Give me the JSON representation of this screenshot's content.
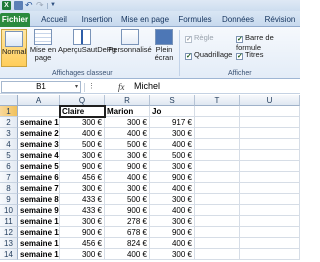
{
  "qat": {
    "excel_icon_label": "X",
    "undo_glyph": "↶",
    "redo_glyph": "↷",
    "dropdown_glyph": "▼"
  },
  "tabs": [
    {
      "label": "Fichier",
      "kind": "file"
    },
    {
      "label": "Accueil",
      "kind": "normal"
    },
    {
      "label": "Insertion",
      "kind": "normal"
    },
    {
      "label": "Mise en page",
      "kind": "normal"
    },
    {
      "label": "Formules",
      "kind": "normal"
    },
    {
      "label": "Données",
      "kind": "normal"
    },
    {
      "label": "Révision",
      "kind": "normal"
    }
  ],
  "ribbon": {
    "views": {
      "normal": "Normal",
      "page_layout": "Mise en\npage",
      "page_break": "AperçuSautDePg",
      "custom": "Personnalisé",
      "full_screen": "Plein\nécran",
      "group_label": "Affichages classeur"
    },
    "show": {
      "ruler": "Règle",
      "formula_bar": "Barre de formule",
      "gridlines": "Quadrillage",
      "headings": "Titres",
      "group_label": "Afficher",
      "check_glyph": "✓"
    }
  },
  "formula_bar": {
    "name_box": "B1",
    "name_box_arrow": "▾",
    "dots": "⋮",
    "fx": "fx",
    "value": "Michel"
  },
  "grid": {
    "columns": [
      "A",
      "Q",
      "R",
      "S",
      "T",
      "U"
    ],
    "selected_column": "B",
    "rows": [
      {
        "n": "1",
        "cells": [
          "",
          "Claire",
          "Marion",
          "Jo",
          "",
          ""
        ]
      },
      {
        "n": "2",
        "cells": [
          "semaine 1",
          "300 €",
          "300 €",
          "917 €",
          "",
          ""
        ]
      },
      {
        "n": "3",
        "cells": [
          "semaine 2",
          "400 €",
          "400 €",
          "300 €",
          "",
          ""
        ]
      },
      {
        "n": "4",
        "cells": [
          "semaine 3",
          "500 €",
          "500 €",
          "400 €",
          "",
          ""
        ]
      },
      {
        "n": "5",
        "cells": [
          "semaine 4",
          "300 €",
          "300 €",
          "500 €",
          "",
          ""
        ]
      },
      {
        "n": "6",
        "cells": [
          "semaine 5",
          "900 €",
          "900 €",
          "300 €",
          "",
          ""
        ]
      },
      {
        "n": "7",
        "cells": [
          "semaine 6",
          "456 €",
          "400 €",
          "900 €",
          "",
          ""
        ]
      },
      {
        "n": "8",
        "cells": [
          "semaine 7",
          "300 €",
          "300 €",
          "400 €",
          "",
          ""
        ]
      },
      {
        "n": "9",
        "cells": [
          "semaine 8",
          "433 €",
          "500 €",
          "300 €",
          "",
          ""
        ]
      },
      {
        "n": "10",
        "cells": [
          "semaine 9",
          "433 €",
          "900 €",
          "400 €",
          "",
          ""
        ]
      },
      {
        "n": "11",
        "cells": [
          "semaine 10",
          "300 €",
          "278 €",
          "300 €",
          "",
          ""
        ]
      },
      {
        "n": "12",
        "cells": [
          "semaine 11",
          "900 €",
          "678 €",
          "900 €",
          "",
          ""
        ]
      },
      {
        "n": "13",
        "cells": [
          "semaine 12",
          "456 €",
          "824 €",
          "400 €",
          "",
          ""
        ]
      },
      {
        "n": "14",
        "cells": [
          "semaine 13",
          "300 €",
          "400 €",
          "300 €",
          "",
          ""
        ]
      }
    ]
  }
}
